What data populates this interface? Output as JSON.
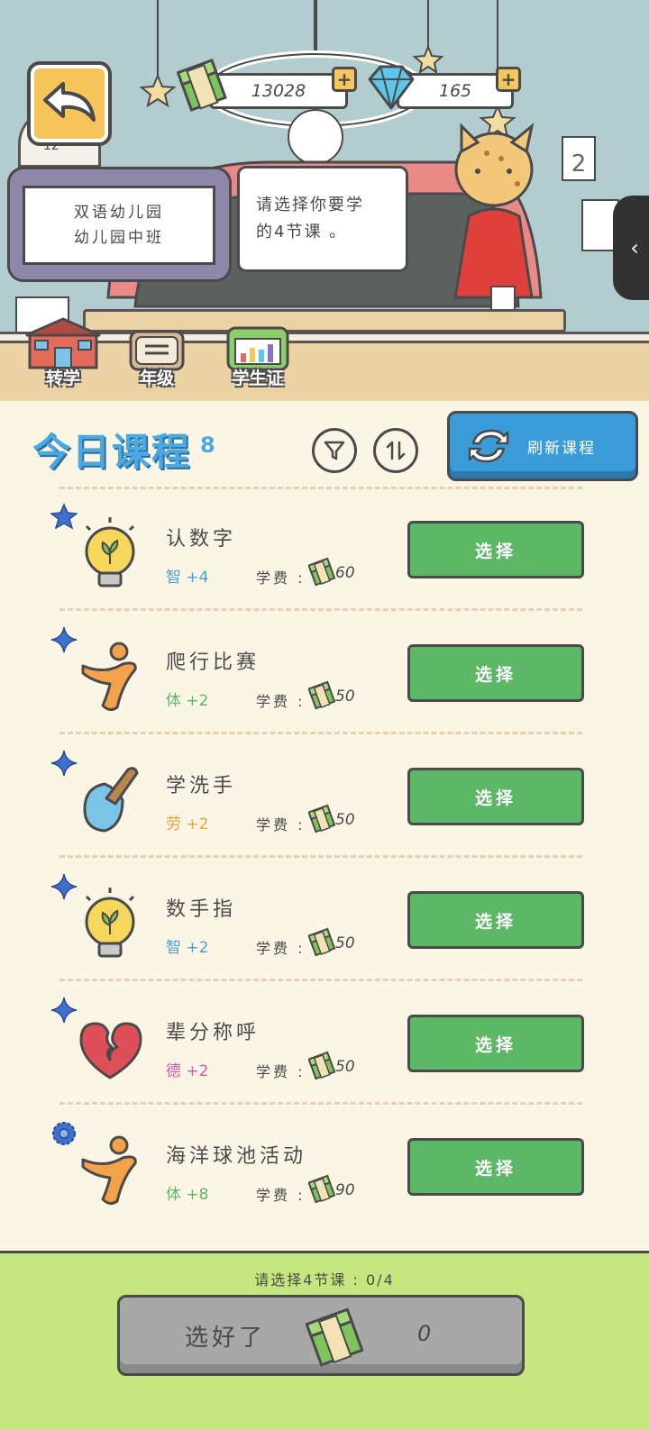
{
  "header": {
    "level": "12",
    "money": "13028",
    "gems": "165"
  },
  "school_sign": {
    "line1": "双语幼儿园",
    "line2": "幼儿园中班"
  },
  "teacher_bubble": {
    "line1": "请选择你要学",
    "line2": "的4节课 。"
  },
  "nav": [
    {
      "label": "转学",
      "icon": "school-building-icon"
    },
    {
      "label": "年级",
      "icon": "grade-card-icon"
    },
    {
      "label": "学生证",
      "icon": "student-id-icon"
    }
  ],
  "courses_header": {
    "title": "今日课程",
    "count": "8",
    "refresh_label": "刷新课程"
  },
  "courses": [
    {
      "name": "认数字",
      "stat": "智 +4",
      "stat_color": "#4a9fe0",
      "fee_label": "学费 :",
      "fee": "60",
      "icon": "lightbulb-icon",
      "star": "star-icon",
      "select_label": "选择"
    },
    {
      "name": "爬行比赛",
      "stat": "体 +2",
      "stat_color": "#5cb867",
      "fee_label": "学费 :",
      "fee": "50",
      "icon": "athlete-icon",
      "star": "sparkle-icon",
      "select_label": "选择"
    },
    {
      "name": "学洗手",
      "stat": "劳 +2",
      "stat_color": "#e9a43a",
      "fee_label": "学费 :",
      "fee": "50",
      "icon": "shovel-icon",
      "star": "sparkle-icon",
      "select_label": "选择"
    },
    {
      "name": "数手指",
      "stat": "智 +2",
      "stat_color": "#4a9fe0",
      "fee_label": "学费 :",
      "fee": "50",
      "icon": "lightbulb-icon",
      "star": "sparkle-icon",
      "select_label": "选择"
    },
    {
      "name": "辈分称呼",
      "stat": "德 +2",
      "stat_color": "#d757a8",
      "fee_label": "学费 :",
      "fee": "50",
      "icon": "heart-icon",
      "star": "sparkle-icon",
      "select_label": "选择"
    },
    {
      "name": "海洋球池活动",
      "stat": "体 +8",
      "stat_color": "#5cb867",
      "fee_label": "学费 :",
      "fee": "90",
      "icon": "athlete-icon",
      "star": "gear-badge-icon",
      "select_label": "选择"
    }
  ],
  "footer": {
    "hint": "请选择4节课 : 0/4",
    "confirm_label": "选好了",
    "confirm_cost": "0"
  }
}
